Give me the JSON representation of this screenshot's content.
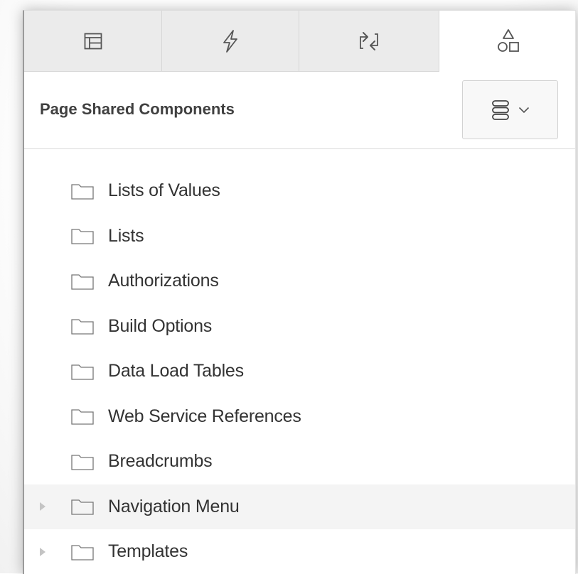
{
  "tabs": [
    {
      "name": "rendering-tree",
      "icon": "tree-layout-icon"
    },
    {
      "name": "dynamic-actions",
      "icon": "lightning-icon"
    },
    {
      "name": "processing",
      "icon": "exchange-icon"
    },
    {
      "name": "shared-components",
      "icon": "shapes-icon",
      "active": true
    }
  ],
  "header": {
    "title": "Page Shared Components",
    "menu_icon": "stacked-list-icon",
    "menu_caret": "chevron-down-icon"
  },
  "tree": {
    "items": [
      {
        "label": "Lists of Values",
        "expandable": false
      },
      {
        "label": "Lists",
        "expandable": false
      },
      {
        "label": "Authorizations",
        "expandable": false
      },
      {
        "label": "Build Options",
        "expandable": false
      },
      {
        "label": "Data Load Tables",
        "expandable": false
      },
      {
        "label": "Web Service References",
        "expandable": false
      },
      {
        "label": "Breadcrumbs",
        "expandable": false
      },
      {
        "label": "Navigation Menu",
        "expandable": true,
        "highlighted": true
      },
      {
        "label": "Templates",
        "expandable": true
      }
    ]
  },
  "colors": {
    "tab_bg": "#ebebeb",
    "active_tab_bg": "#ffffff",
    "text": "#333333",
    "title_text": "#404040",
    "icon_stroke": "#555555",
    "highlight_row": "#f4f4f4"
  }
}
